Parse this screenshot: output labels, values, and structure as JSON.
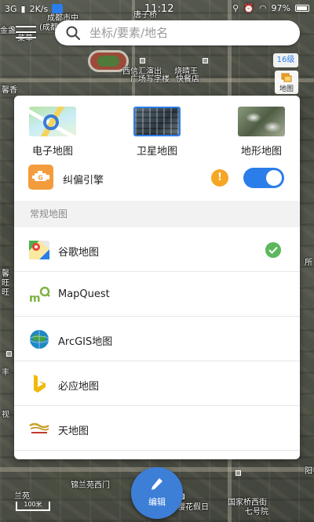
{
  "status_bar": {
    "network": "3G",
    "speed": "2K/s",
    "time": "11:12",
    "battery": "97%"
  },
  "map": {
    "labels": {
      "top_left_a": "成都市中",
      "top_left_b": "(成都市",
      "top_left_c": "金盏",
      "top_left_d": "菜草",
      "top_center": "唐子桥",
      "mid_a": "西信汇演出",
      "mid_b": "馨香",
      "mid_c": "广场写字楼",
      "mid_d": "烧晴王",
      "mid_e": "快餐店",
      "left_a": "馨",
      "left_b": "旺",
      "left_c": "旺",
      "left_d": "丰",
      "left_e": "视",
      "bottom_a": "锦兰苑西门",
      "bottom_b": "樱花假日",
      "bottom_c": "国家桥西街",
      "bottom_d": "七号院",
      "bottom_e": "兰苑",
      "right_a": "所",
      "right_b": "阳"
    },
    "scale_label": "100米"
  },
  "search": {
    "placeholder": "坐标/要素/地名"
  },
  "zoom_level": "16级",
  "layer_button_label": "地图",
  "panel": {
    "map_types": [
      {
        "name": "电子地图"
      },
      {
        "name": "卫星地图",
        "selected": true
      },
      {
        "name": "地形地图"
      }
    ],
    "engine": {
      "label": "纠偏引擎",
      "enabled": true
    },
    "section_title": "常规地图",
    "providers": [
      {
        "name": "谷歌地图",
        "selected": true
      },
      {
        "name": "MapQuest"
      },
      {
        "name": "ArcGIS地图"
      },
      {
        "name": "必应地图"
      },
      {
        "name": "天地图"
      }
    ]
  },
  "fab": {
    "label": "编辑"
  },
  "colors": {
    "accent": "#2b7de9",
    "warning": "#f5a623",
    "check": "#5cb85c",
    "engine": "#f39c3d"
  }
}
